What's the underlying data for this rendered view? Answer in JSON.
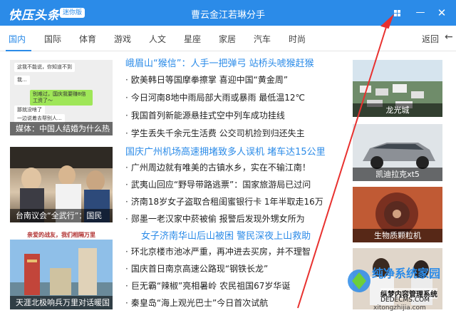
{
  "titlebar": {
    "logo": "快压头条",
    "badge": "迷你版",
    "title": "曹云金江若琳分手",
    "grid_glyph": "grid-icon",
    "min_glyph": "—",
    "close_glyph": "✕"
  },
  "tabs": {
    "items": [
      "国内",
      "国际",
      "体育",
      "游戏",
      "人文",
      "星座",
      "家居",
      "汽车",
      "时尚"
    ],
    "active": "国内",
    "back_label": "返回",
    "back_arrow": "←"
  },
  "left_thumbs": {
    "chat": {
      "bubbles": [
        "这我不能说，你知道不到",
        "我...",
        "别难过，国庆我要赚8倍工资了～",
        "那就没啥了",
        "一边说着去帮别人..."
      ],
      "caption": "媒体：中国人结婚为什么热"
    },
    "crowd": {
      "caption": "台南议会“全武行”：国民"
    },
    "tower": {
      "banner": "亲爱的战友，我们相隔万里",
      "caption": "天涯北极响兵万里对话暖国"
    }
  },
  "news": [
    {
      "text": "峨眉山“猴信”：人手一把弹弓 站桥头唬猴赶猴",
      "head": true
    },
    {
      "text": "欧美韩日等国摩拳擦掌 喜迎中国“黄金周”",
      "head": false
    },
    {
      "text": "今日河南8地中雨局部大雨或暴雨 最低温12℃",
      "head": false
    },
    {
      "text": "我国首列新能源悬挂式空中列车成功挂线",
      "head": false
    },
    {
      "text": "学生丢失千余元生活费 公交司机捡到归还失主",
      "head": false
    },
    {
      "text": "国庆广州机场高速拥堵致多人误机 堵车达15公里",
      "head": true
    },
    {
      "text": "广州周边就有唯美的古镇水乡，实在不输江南！",
      "head": false
    },
    {
      "text": "武夷山回应“野导带路逃票”：国家旅游局已过问",
      "head": false
    },
    {
      "text": "济南18岁女子盗取合租闺蜜银行卡 1年半取走16万",
      "head": false
    },
    {
      "text": "郧墨一老汉家中菸被偷 报警后发现外甥女所为",
      "head": false
    },
    {
      "text": "女子济南华山后山被困 警民深夜上山救助",
      "head": true
    },
    {
      "text": "环北京楼市池冰严重，再冲进去买房，并不理智",
      "head": false
    },
    {
      "text": "国庆首日南京高速公路现“钢铁长龙”",
      "head": false
    },
    {
      "text": "巨无霸“辣椒”亮相暑岭 农民祖国67岁华诞",
      "head": false
    },
    {
      "text": "秦皇岛“海上观光巴士”今日首次试航",
      "head": false
    }
  ],
  "right_thumbs": [
    {
      "caption": "龙光城"
    },
    {
      "caption": "凯迪拉克xt5"
    },
    {
      "caption": "生物质颗粒机"
    },
    {
      "caption": ""
    }
  ],
  "watermark": {
    "line1": "纯净系统家园",
    "line2": "xitongzhijia.com",
    "overlay1": "纵梦内容管理系统",
    "overlay2": "DEDECMS.COM"
  },
  "colors": {
    "accent": "#2b8be8",
    "annotation_arrow": "#e8312f"
  }
}
